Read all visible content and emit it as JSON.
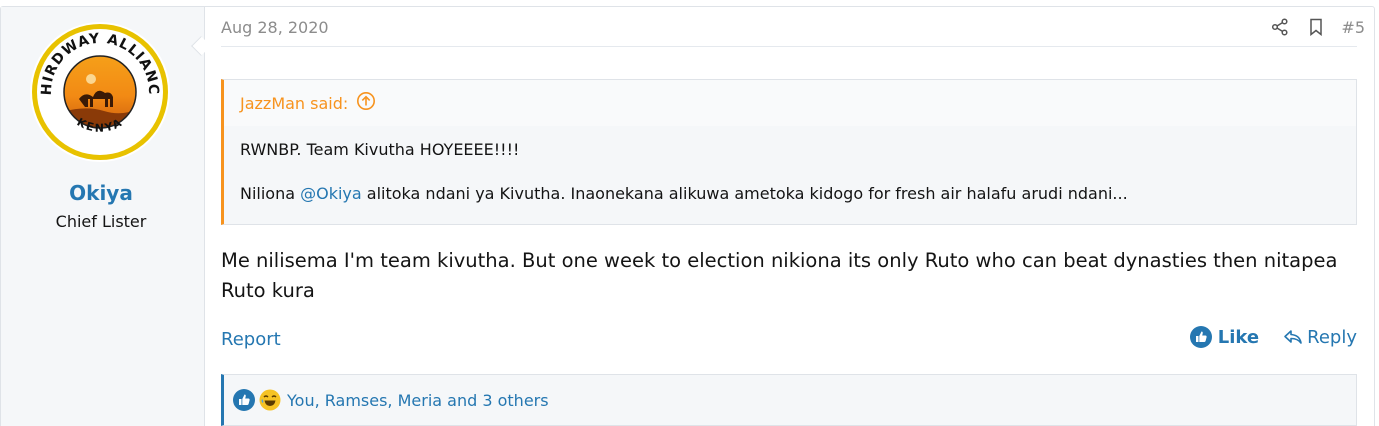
{
  "post": {
    "date": "Aug 28, 2020",
    "number": "#5",
    "message": "Me nilisema I'm team kivutha. But one week to election nikiona its only Ruto who can beat dynasties then nitapea Ruto kura"
  },
  "user": {
    "name": "Okiya",
    "title": "Chief Lister",
    "avatar": {
      "top_text": "THIRDWAY ALLIANCE",
      "bottom_text": "KENYA"
    }
  },
  "quote": {
    "author_label": "JazzMan said:",
    "line1": "RWNBP. Team Kivutha HOYEEEE!!!!",
    "line2_before": "Niliona ",
    "line2_mention": "@Okiya",
    "line2_after": " alitoka ndani ya Kivutha. Inaonekana alikuwa ametoka kidogo for fresh air halafu arudi ndani..."
  },
  "actions": {
    "report": "Report",
    "like": "Like",
    "reply": "Reply"
  },
  "reactions": {
    "summary": "You, Ramses, Meria and 3 others"
  },
  "colors": {
    "link": "#2577b1",
    "quote_accent": "#f7931e",
    "meta": "#8c8c8c"
  }
}
